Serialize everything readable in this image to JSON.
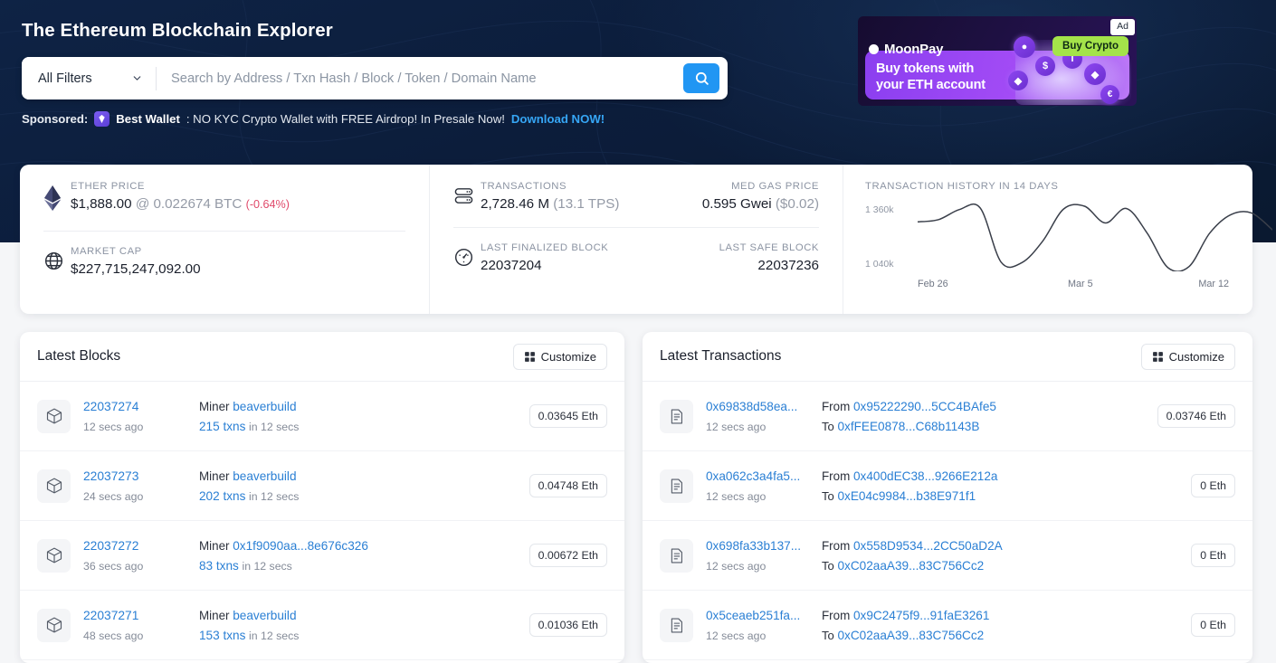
{
  "header": {
    "title": "The Ethereum Blockchain Explorer",
    "filter_label": "All Filters",
    "search_placeholder": "Search by Address / Txn Hash / Block / Token / Domain Name",
    "search_value": "",
    "search_icon": "search-icon",
    "chevron_icon": "chevron-down-icon"
  },
  "sponsored": {
    "label": "Sponsored:",
    "icon": "best-wallet-icon",
    "name": "Best Wallet",
    "text": ": NO KYC Crypto Wallet with FREE Airdrop! In Presale Now!",
    "cta": "Download NOW!"
  },
  "ad": {
    "tag": "Ad",
    "brand": "MoonPay",
    "button": "Buy Crypto",
    "headline_line1": "Buy tokens with",
    "headline_line2": "your ETH account",
    "accent": "#a4e34a",
    "purple": "#a24bf5"
  },
  "stats": {
    "ether_price": {
      "icon": "ethereum-icon",
      "label": "ETHER PRICE",
      "value": "$1,888.00",
      "at": "@ 0.022674 BTC",
      "change": "(-0.64%)",
      "change_color": "#e0496a"
    },
    "market_cap": {
      "icon": "globe-icon",
      "label": "MARKET CAP",
      "value": "$227,715,247,092.00"
    },
    "transactions": {
      "icon": "database-icon",
      "label": "TRANSACTIONS",
      "value": "2,728.46 M",
      "tps": "(13.1 TPS)"
    },
    "med_gas_price": {
      "label": "MED GAS PRICE",
      "value": "0.595 Gwei",
      "usd": "($0.02)"
    },
    "last_finalized_block": {
      "icon": "gauge-icon",
      "label": "LAST FINALIZED BLOCK",
      "value": "22037204"
    },
    "last_safe_block": {
      "label": "LAST SAFE BLOCK",
      "value": "22037236"
    }
  },
  "chart_data": {
    "type": "line",
    "title": "TRANSACTION HISTORY IN 14 DAYS",
    "xlabel": "",
    "ylabel": "",
    "grid": false,
    "legend": false,
    "ytick_labels": [
      "1 360k",
      "1 040k"
    ],
    "ylim": [
      1040000,
      1360000
    ],
    "xtick_labels": [
      "Feb 26",
      "Mar 5",
      "Mar 12"
    ],
    "x": [
      "Feb 26",
      "Feb 27",
      "Feb 28",
      "Mar 1",
      "Mar 2",
      "Mar 3",
      "Mar 4",
      "Mar 5",
      "Mar 6",
      "Mar 7",
      "Mar 8",
      "Mar 9",
      "Mar 10",
      "Mar 11",
      "Mar 12"
    ],
    "values": [
      1290000,
      1300000,
      1345000,
      1352000,
      1110000,
      1108000,
      1205000,
      1348000,
      1360000,
      1285000,
      1350000,
      1240000,
      1085000,
      1090000,
      1240000,
      1322000,
      1330000,
      1255000
    ]
  },
  "blocks_panel": {
    "title": "Latest Blocks",
    "customize": "Customize",
    "customize_icon": "grid-icon",
    "row_icon": "cube-icon",
    "miner_label": "Miner",
    "in_label": "in 12 secs",
    "rows": [
      {
        "number": "22037274",
        "age": "12 secs ago",
        "miner": "beaverbuild",
        "txns": "215 txns",
        "in": "in 12 secs",
        "reward": "0.03645 Eth"
      },
      {
        "number": "22037273",
        "age": "24 secs ago",
        "miner": "beaverbuild",
        "txns": "202 txns",
        "in": "in 12 secs",
        "reward": "0.04748 Eth"
      },
      {
        "number": "22037272",
        "age": "36 secs ago",
        "miner": "0x1f9090aa...8e676c326",
        "txns": "83 txns",
        "in": "in 12 secs",
        "reward": "0.00672 Eth"
      },
      {
        "number": "22037271",
        "age": "48 secs ago",
        "miner": "beaverbuild",
        "txns": "153 txns",
        "in": "in 12 secs",
        "reward": "0.01036 Eth"
      }
    ]
  },
  "txns_panel": {
    "title": "Latest Transactions",
    "customize": "Customize",
    "customize_icon": "grid-icon",
    "row_icon": "document-icon",
    "from_label": "From",
    "to_label": "To",
    "rows": [
      {
        "hash": "0x69838d58ea...",
        "age": "12 secs ago",
        "from": "0x95222290...5CC4BAfe5",
        "to": "0xfFEE0878...C68b1143B",
        "value": "0.03746 Eth"
      },
      {
        "hash": "0xa062c3a4fa5...",
        "age": "12 secs ago",
        "from": "0x400dEC38...9266E212a",
        "to": "0xE04c9984...b38E971f1",
        "value": "0 Eth"
      },
      {
        "hash": "0x698fa33b137...",
        "age": "12 secs ago",
        "from": "0x558D9534...2CC50aD2A",
        "to": "0xC02aaA39...83C756Cc2",
        "value": "0 Eth"
      },
      {
        "hash": "0x5ceaeb251fa...",
        "age": "12 secs ago",
        "from": "0x9C2475f9...91faE3261",
        "to": "0xC02aaA39...83C756Cc2",
        "value": "0 Eth"
      }
    ]
  }
}
